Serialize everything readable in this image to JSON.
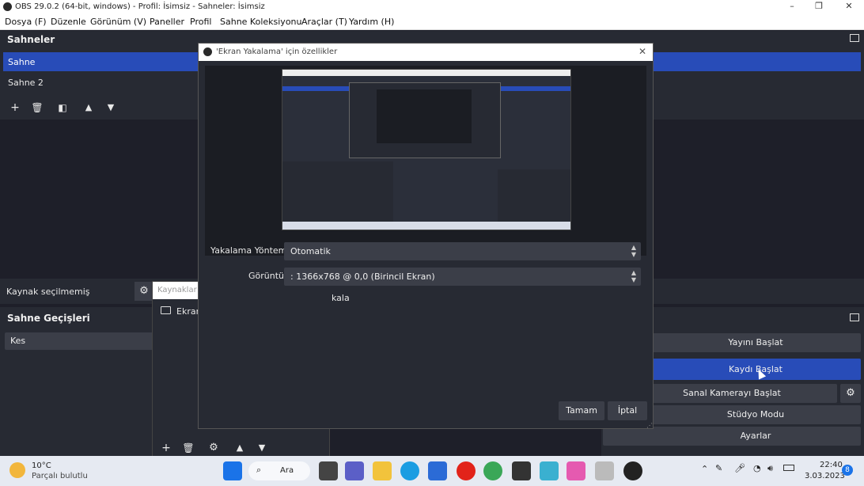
{
  "window": {
    "title": "OBS 29.0.2 (64-bit, windows) - Profil: İsimsiz - Sahneler: İsimsiz"
  },
  "menu": [
    "Dosya (F)",
    "Düzenle",
    "Görünüm (V)",
    "Paneller",
    "Profil",
    "Sahne Koleksiyonu",
    "Araçlar (T)",
    "Yardım (H)"
  ],
  "scenes": {
    "header": "Sahneler",
    "items": [
      "Sahne",
      "Sahne 2"
    ]
  },
  "source_bar": {
    "no_source": "Kaynak seçilmemiş"
  },
  "transitions": {
    "header": "Sahne Geçişleri",
    "selected": "Kes"
  },
  "sources": {
    "header": "Kaynaklar",
    "items": [
      "Ekran Yakalama"
    ]
  },
  "controls": {
    "start_stream": "Yayını Başlat",
    "start_record": "Kaydı Başlat",
    "start_vcam": "Sanal Kamerayı Başlat",
    "studio_mode": "Stüdyo Modu",
    "settings": "Ayarlar"
  },
  "dialog": {
    "title": "'Ekran Yakalama' için özellikler",
    "capture_method_label": "Yakalama Yöntemi",
    "capture_method_value": "Otomatik",
    "display_label": "Görüntü",
    "display_value": ": 1366x768 @ 0,0 (Birincil Ekran)",
    "capture_cursor_fragment": "kala",
    "ok": "Tamam",
    "cancel": "İptal"
  },
  "taskbar": {
    "weather_temp": "10°C",
    "weather_desc": "Parçalı bulutlu",
    "search": "Ara",
    "time": "22:40",
    "date": "3.03.2023",
    "notifications": "8"
  },
  "colors": {
    "accent": "#284cb8",
    "panel": "#272a33",
    "background": "#1e1f29"
  }
}
